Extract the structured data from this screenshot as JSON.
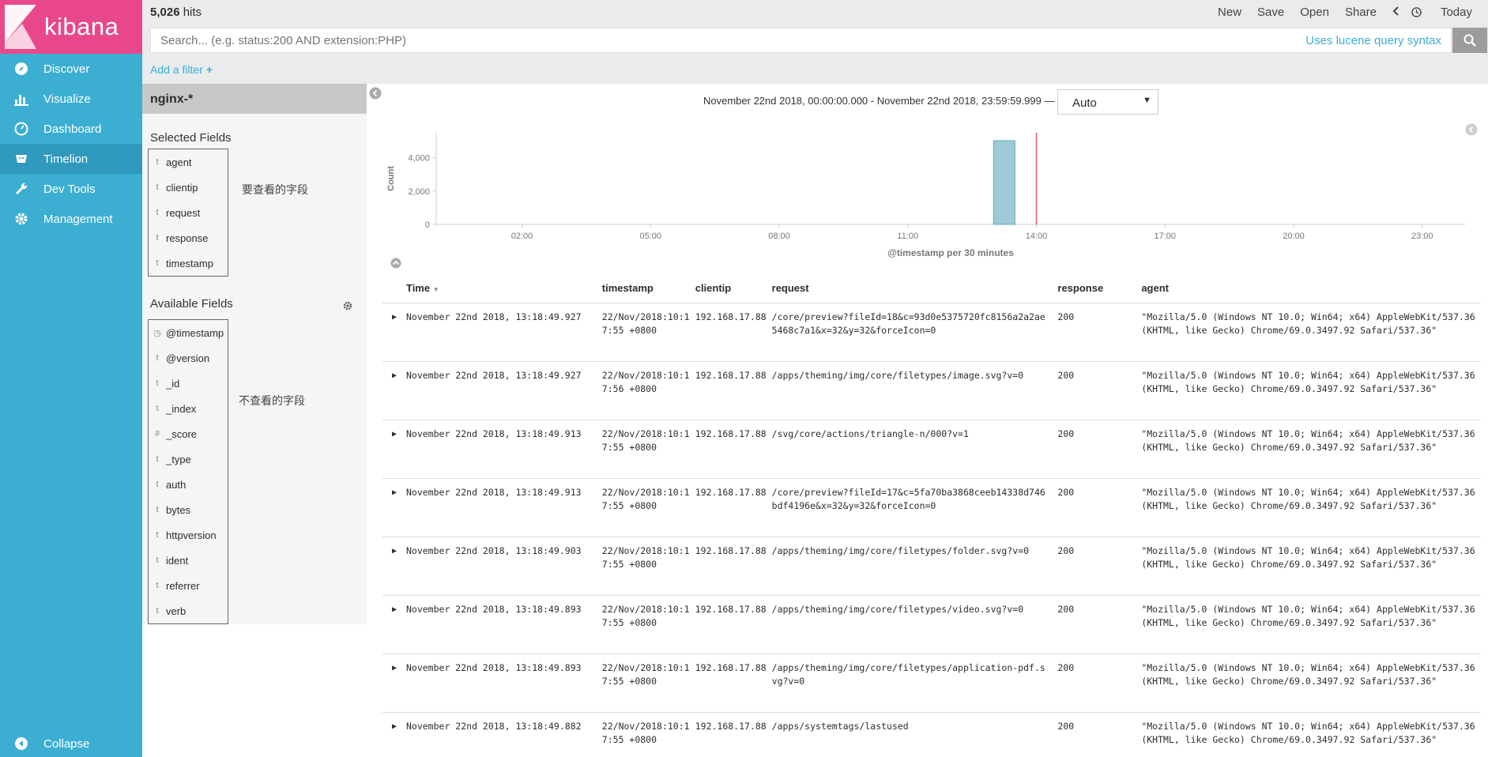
{
  "app": {
    "logo_text": "kibana"
  },
  "sidebar": {
    "items": [
      {
        "label": "Discover",
        "icon": "compass-icon"
      },
      {
        "label": "Visualize",
        "icon": "bar-chart-icon"
      },
      {
        "label": "Dashboard",
        "icon": "dashboard-icon"
      },
      {
        "label": "Timelion",
        "icon": "timelion-icon"
      },
      {
        "label": "Dev Tools",
        "icon": "wrench-icon"
      },
      {
        "label": "Management",
        "icon": "gear-icon"
      }
    ],
    "collapse_label": "Collapse"
  },
  "topbar": {
    "hits_count": "5,026",
    "hits_label": "hits",
    "menu": {
      "new": "New",
      "save": "Save",
      "open": "Open",
      "share": "Share",
      "today": "Today"
    }
  },
  "search": {
    "placeholder": "Search... (e.g. status:200 AND extension:PHP)",
    "lucene_link": "Uses lucene query syntax"
  },
  "filter": {
    "add_label": "Add a filter"
  },
  "field_panel": {
    "index_pattern": "nginx-*",
    "selected_title": "Selected Fields",
    "selected_fields": [
      {
        "type": "t",
        "name": "agent"
      },
      {
        "type": "t",
        "name": "clientip"
      },
      {
        "type": "t",
        "name": "request"
      },
      {
        "type": "t",
        "name": "response"
      },
      {
        "type": "t",
        "name": "timestamp"
      }
    ],
    "selected_note": "要查看的字段",
    "available_title": "Available Fields",
    "available_fields": [
      {
        "type": "◷",
        "name": "@timestamp"
      },
      {
        "type": "t",
        "name": "@version"
      },
      {
        "type": "t",
        "name": "_id"
      },
      {
        "type": "t",
        "name": "_index"
      },
      {
        "type": "#",
        "name": "_score"
      },
      {
        "type": "t",
        "name": "_type"
      },
      {
        "type": "t",
        "name": "auth"
      },
      {
        "type": "t",
        "name": "bytes"
      },
      {
        "type": "t",
        "name": "httpversion"
      },
      {
        "type": "t",
        "name": "ident"
      },
      {
        "type": "t",
        "name": "referrer"
      },
      {
        "type": "t",
        "name": "verb"
      }
    ],
    "available_note": "不查看的字段"
  },
  "main": {
    "date_range": "November 22nd 2018, 00:00:00.000 - November 22nd 2018, 23:59:59.999 —",
    "interval": "Auto"
  },
  "chart_data": {
    "type": "bar",
    "ylabel": "Count",
    "xlabel": "@timestamp per 30 minutes",
    "y_ticks": [
      "0",
      "2,000",
      "4,000"
    ],
    "x_ticks": [
      "02:00",
      "05:00",
      "08:00",
      "11:00",
      "14:00",
      "17:00",
      "20:00",
      "23:00"
    ],
    "ylim": [
      0,
      5500
    ],
    "xlim_hours": [
      0,
      24
    ],
    "bars": [
      {
        "x": "13:00",
        "value": 5026
      }
    ],
    "marker_line_x": "14:00"
  },
  "table": {
    "headers": [
      "Time",
      "timestamp",
      "clientip",
      "request",
      "response",
      "agent"
    ],
    "rows": [
      {
        "time": "November 22nd 2018, 13:18:49.927",
        "timestamp": "22/Nov/2018:10:17:55 +0800",
        "clientip": "192.168.17.88",
        "request": "/core/preview?fileId=18&c=93d0e5375720fc8156a2a2ae5468c7a1&x=32&y=32&forceIcon=0",
        "response": "200",
        "agent": "\"Mozilla/5.0 (Windows NT 10.0; Win64; x64) AppleWebKit/537.36 (KHTML, like Gecko) Chrome/69.0.3497.92 Safari/537.36\""
      },
      {
        "time": "November 22nd 2018, 13:18:49.927",
        "timestamp": "22/Nov/2018:10:17:56 +0800",
        "clientip": "192.168.17.88",
        "request": "/apps/theming/img/core/filetypes/image.svg?v=0",
        "response": "200",
        "agent": "\"Mozilla/5.0 (Windows NT 10.0; Win64; x64) AppleWebKit/537.36 (KHTML, like Gecko) Chrome/69.0.3497.92 Safari/537.36\""
      },
      {
        "time": "November 22nd 2018, 13:18:49.913",
        "timestamp": "22/Nov/2018:10:17:55 +0800",
        "clientip": "192.168.17.88",
        "request": "/svg/core/actions/triangle-n/000?v=1",
        "response": "200",
        "agent": "\"Mozilla/5.0 (Windows NT 10.0; Win64; x64) AppleWebKit/537.36 (KHTML, like Gecko) Chrome/69.0.3497.92 Safari/537.36\""
      },
      {
        "time": "November 22nd 2018, 13:18:49.913",
        "timestamp": "22/Nov/2018:10:17:55 +0800",
        "clientip": "192.168.17.88",
        "request": "/core/preview?fileId=17&c=5fa70ba3868ceeb14338d746bdf4196e&x=32&y=32&forceIcon=0",
        "response": "200",
        "agent": "\"Mozilla/5.0 (Windows NT 10.0; Win64; x64) AppleWebKit/537.36 (KHTML, like Gecko) Chrome/69.0.3497.92 Safari/537.36\""
      },
      {
        "time": "November 22nd 2018, 13:18:49.903",
        "timestamp": "22/Nov/2018:10:17:55 +0800",
        "clientip": "192.168.17.88",
        "request": "/apps/theming/img/core/filetypes/folder.svg?v=0",
        "response": "200",
        "agent": "\"Mozilla/5.0 (Windows NT 10.0; Win64; x64) AppleWebKit/537.36 (KHTML, like Gecko) Chrome/69.0.3497.92 Safari/537.36\""
      },
      {
        "time": "November 22nd 2018, 13:18:49.893",
        "timestamp": "22/Nov/2018:10:17:55 +0800",
        "clientip": "192.168.17.88",
        "request": "/apps/theming/img/core/filetypes/video.svg?v=0",
        "response": "200",
        "agent": "\"Mozilla/5.0 (Windows NT 10.0; Win64; x64) AppleWebKit/537.36 (KHTML, like Gecko) Chrome/69.0.3497.92 Safari/537.36\""
      },
      {
        "time": "November 22nd 2018, 13:18:49.893",
        "timestamp": "22/Nov/2018:10:17:55 +0800",
        "clientip": "192.168.17.88",
        "request": "/apps/theming/img/core/filetypes/application-pdf.svg?v=0",
        "response": "200",
        "agent": "\"Mozilla/5.0 (Windows NT 10.0; Win64; x64) AppleWebKit/537.36 (KHTML, like Gecko) Chrome/69.0.3497.92 Safari/537.36\""
      },
      {
        "time": "November 22nd 2018, 13:18:49.882",
        "timestamp": "22/Nov/2018:10:17:55 +0800",
        "clientip": "192.168.17.88",
        "request": "/apps/systemtags/lastused",
        "response": "200",
        "agent": "\"Mozilla/5.0 (Windows NT 10.0; Win64; x64) AppleWebKit/537.36 (KHTML, like Gecko) Chrome/69.0.3497.92 Safari/537.36\""
      }
    ]
  },
  "colors": {
    "sidebar": "#3caed2",
    "logo_bg": "#e8488b",
    "bar": "#9ccad7",
    "marker": "#e35c5c",
    "link": "#3caed2"
  }
}
